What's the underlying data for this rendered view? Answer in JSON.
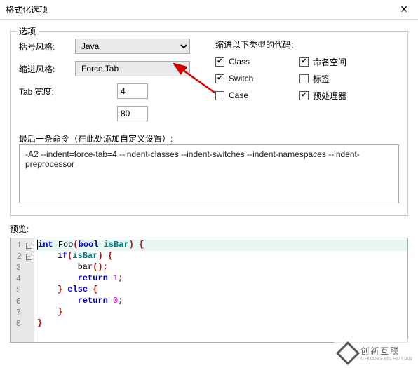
{
  "window": {
    "title": "格式化选项",
    "close": "✕"
  },
  "options": {
    "group_label": "选项",
    "brace_style_label": "括号风格:",
    "brace_style_value": "Java",
    "indent_style_label": "缩进风格:",
    "indent_style_value": "Force Tab",
    "tab_width_label": "Tab 宽度:",
    "tab_width_value": "4",
    "wrap_value": "80",
    "indent_heading": "缩进以下类型的代码:",
    "checks": [
      {
        "label": "Class",
        "checked": true
      },
      {
        "label": "命名空间",
        "checked": true
      },
      {
        "label": "Switch",
        "checked": true
      },
      {
        "label": "标签",
        "checked": false
      },
      {
        "label": "Case",
        "checked": false
      },
      {
        "label": "预处理器",
        "checked": true
      }
    ],
    "last_cmd_label": "最后一条命令（在此处添加自定义设置）:",
    "last_cmd_value": "-A2 --indent=force-tab=4 --indent-classes --indent-switches --indent-namespaces --indent-preprocessor"
  },
  "preview": {
    "label": "预览:",
    "lines": [
      "int Foo(bool isBar) {",
      "    if(isBar) {",
      "        bar();",
      "        return 1;",
      "    } else {",
      "        return 0;",
      "    }",
      "}"
    ]
  },
  "watermark": {
    "line1": "创新互联",
    "line2": "CHUANG XIN HU LIAN"
  }
}
